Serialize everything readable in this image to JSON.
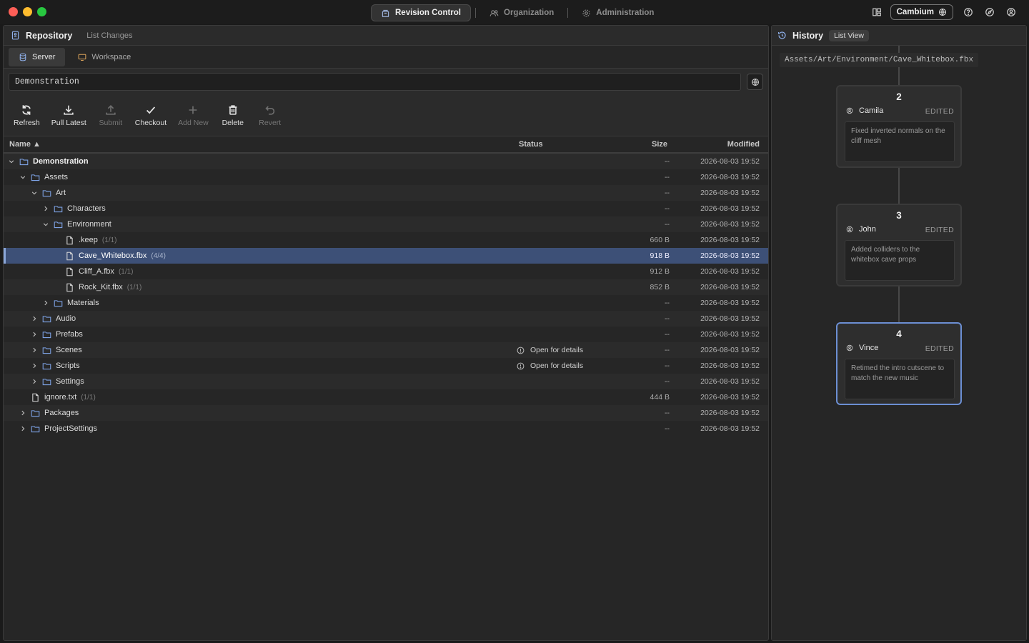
{
  "topnav": {
    "tabs": [
      {
        "label": "Revision Control",
        "active": true,
        "icon": "box-icon"
      },
      {
        "label": "Organization",
        "active": false,
        "icon": "users-icon"
      },
      {
        "label": "Administration",
        "active": false,
        "icon": "gear-icon"
      }
    ],
    "org_label": "Cambium",
    "right_icons": [
      "layout-icon",
      "help-icon",
      "compass-icon",
      "account-icon"
    ]
  },
  "repository": {
    "title": "Repository",
    "subtitle": "List Changes",
    "tabs": [
      {
        "label": "Server",
        "active": true
      },
      {
        "label": "Workspace",
        "active": false
      }
    ],
    "path_value": "Demonstration",
    "toolbar": [
      {
        "label": "Refresh",
        "icon": "refresh-icon",
        "enabled": true
      },
      {
        "label": "Pull Latest",
        "icon": "download-icon",
        "enabled": true
      },
      {
        "label": "Submit",
        "icon": "upload-icon",
        "enabled": false
      },
      {
        "label": "Checkout",
        "icon": "check-icon",
        "enabled": true
      },
      {
        "label": "Add New",
        "icon": "plus-icon",
        "enabled": false
      },
      {
        "label": "Delete",
        "icon": "trash-icon",
        "enabled": true
      },
      {
        "label": "Revert",
        "icon": "undo-icon",
        "enabled": false
      }
    ],
    "columns": {
      "name": "Name ▲",
      "status": "Status",
      "size": "Size",
      "modified": "Modified"
    },
    "rows": [
      {
        "name": "Demonstration",
        "type": "folder",
        "depth": 0,
        "expanded": true,
        "bold": true,
        "version": "",
        "status": "",
        "size": "--",
        "modified": "2026-08-03 19:52"
      },
      {
        "name": "Assets",
        "type": "folder",
        "depth": 1,
        "expanded": true,
        "version": "",
        "status": "",
        "size": "--",
        "modified": "2026-08-03 19:52"
      },
      {
        "name": "Art",
        "type": "folder",
        "depth": 2,
        "expanded": true,
        "version": "",
        "status": "",
        "size": "--",
        "modified": "2026-08-03 19:52"
      },
      {
        "name": "Characters",
        "type": "folder",
        "depth": 3,
        "expanded": false,
        "version": "",
        "status": "",
        "size": "--",
        "modified": "2026-08-03 19:52"
      },
      {
        "name": "Environment",
        "type": "folder",
        "depth": 3,
        "expanded": true,
        "version": "",
        "status": "",
        "size": "--",
        "modified": "2026-08-03 19:52"
      },
      {
        "name": ".keep",
        "type": "file",
        "depth": 4,
        "version": "(1/1)",
        "status": "",
        "size": "660 B",
        "modified": "2026-08-03 19:52"
      },
      {
        "name": "Cave_Whitebox.fbx",
        "type": "file",
        "depth": 4,
        "version": "(4/4)",
        "status": "",
        "size": "918 B",
        "modified": "2026-08-03 19:52",
        "selected": true
      },
      {
        "name": "Cliff_A.fbx",
        "type": "file",
        "depth": 4,
        "version": "(1/1)",
        "status": "",
        "size": "912 B",
        "modified": "2026-08-03 19:52"
      },
      {
        "name": "Rock_Kit.fbx",
        "type": "file",
        "depth": 4,
        "version": "(1/1)",
        "status": "",
        "size": "852 B",
        "modified": "2026-08-03 19:52"
      },
      {
        "name": "Materials",
        "type": "folder",
        "depth": 3,
        "expanded": false,
        "version": "",
        "status": "",
        "size": "--",
        "modified": "2026-08-03 19:52"
      },
      {
        "name": "Audio",
        "type": "folder",
        "depth": 2,
        "expanded": false,
        "version": "",
        "status": "",
        "size": "--",
        "modified": "2026-08-03 19:52"
      },
      {
        "name": "Prefabs",
        "type": "folder",
        "depth": 2,
        "expanded": false,
        "version": "",
        "status": "",
        "size": "--",
        "modified": "2026-08-03 19:52"
      },
      {
        "name": "Scenes",
        "type": "folder",
        "depth": 2,
        "expanded": false,
        "version": "",
        "status": "Open for details",
        "size": "--",
        "modified": "2026-08-03 19:52"
      },
      {
        "name": "Scripts",
        "type": "folder",
        "depth": 2,
        "expanded": false,
        "version": "",
        "status": "Open for details",
        "size": "--",
        "modified": "2026-08-03 19:52"
      },
      {
        "name": "Settings",
        "type": "folder",
        "depth": 2,
        "expanded": false,
        "version": "",
        "status": "",
        "size": "--",
        "modified": "2026-08-03 19:52"
      },
      {
        "name": "ignore.txt",
        "type": "file",
        "depth": 1,
        "version": "(1/1)",
        "status": "",
        "size": "444 B",
        "modified": "2026-08-03 19:52"
      },
      {
        "name": "Packages",
        "type": "folder",
        "depth": 1,
        "expanded": false,
        "version": "",
        "status": "",
        "size": "--",
        "modified": "2026-08-03 19:52"
      },
      {
        "name": "ProjectSettings",
        "type": "folder",
        "depth": 1,
        "expanded": false,
        "version": "",
        "status": "",
        "size": "--",
        "modified": "2026-08-03 19:52"
      }
    ]
  },
  "history": {
    "title": "History",
    "view_label": "List View",
    "path": "Assets/Art/Environment/Cave_Whitebox.fbx",
    "changes": [
      {
        "number": "2",
        "author": "Camila",
        "action": "EDITED",
        "message": "Fixed inverted normals on the cliff mesh",
        "selected": false
      },
      {
        "number": "3",
        "author": "John",
        "action": "EDITED",
        "message": "Added colliders to the whitebox cave props",
        "selected": false
      },
      {
        "number": "4",
        "author": "Vince",
        "action": "EDITED",
        "message": "Retimed the intro cutscene to match the new music",
        "selected": true
      }
    ]
  },
  "colors": {
    "accent": "#6c8fd3",
    "selection": "#3d5077",
    "folder_icon": "#7ea3e6"
  }
}
